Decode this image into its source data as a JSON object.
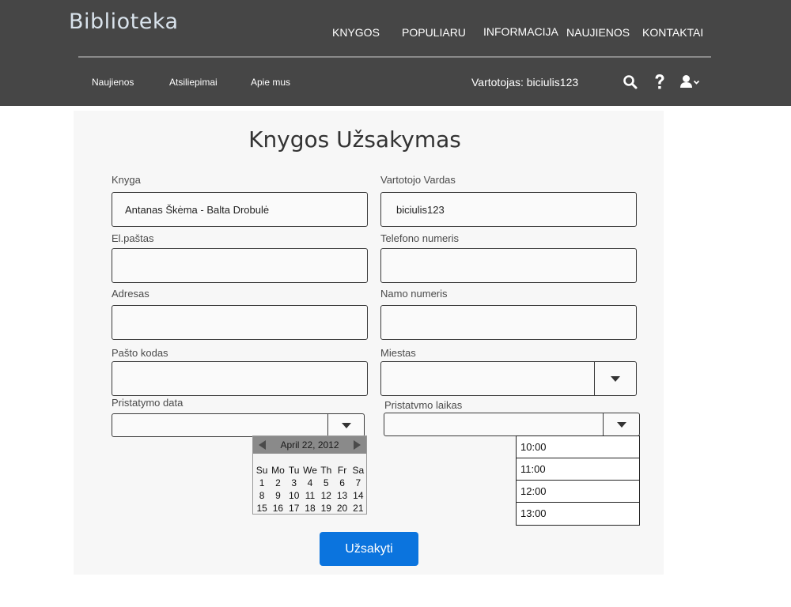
{
  "header": {
    "logo": "Biblioteka",
    "main_nav": [
      "KNYGOS",
      "POPULIARU",
      "INFORMACIJA",
      "NAUJIENOS",
      "KONTAKTAI"
    ],
    "sub_nav": [
      "Naujienos",
      "Atsiliepimai",
      "Apie mus"
    ],
    "user_label": "Vartotojas: biciulis123",
    "icons": [
      "search-icon",
      "help-icon",
      "user-menu-icon"
    ]
  },
  "form": {
    "title": "Knygos Užsakymas",
    "fields": {
      "knyga": {
        "label": "Knyga",
        "value": "Antanas Škėma - Balta Drobulė"
      },
      "vardas": {
        "label": "Vartotojo Vardas",
        "value": "biciulis123"
      },
      "pastas": {
        "label": "El.paštas",
        "value": ""
      },
      "telefonas": {
        "label": "Telefono numeris",
        "value": ""
      },
      "adresas": {
        "label": "Adresas",
        "value": ""
      },
      "namo": {
        "label": "Namo numeris",
        "value": ""
      },
      "kodas": {
        "label": "Pašto kodas",
        "value": ""
      },
      "miestas": {
        "label": "Miestas",
        "value": ""
      },
      "data": {
        "label": "Pristatymo data",
        "value": ""
      },
      "laikas": {
        "label": "Pristatvmo laikas",
        "value": ""
      }
    },
    "calendar": {
      "month_label": "April 22, 2012",
      "weekdays": [
        "Su",
        "Mo",
        "Tu",
        "We",
        "Th",
        "Fr",
        "Sa"
      ],
      "weeks": [
        [
          "1",
          "2",
          "3",
          "4",
          "5",
          "6",
          "7"
        ],
        [
          "8",
          "9",
          "10",
          "11",
          "12",
          "13",
          "14"
        ],
        [
          "15",
          "16",
          "17",
          "18",
          "19",
          "20",
          "21"
        ]
      ]
    },
    "time_options": [
      "10:00",
      "11:00",
      "12:00",
      "13:00"
    ],
    "submit_label": "Užsakyti"
  },
  "colors": {
    "header_bg": "#464646",
    "panel_bg": "#f7f7f7",
    "button_bg": "#0b74de"
  }
}
